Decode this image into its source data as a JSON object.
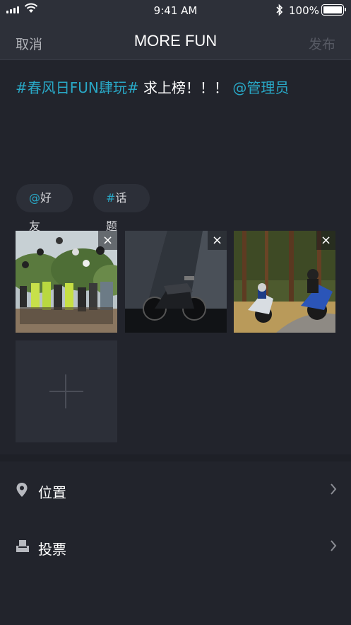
{
  "status_bar": {
    "time": "9:41 AM",
    "battery": "100%",
    "icons": [
      "signal-icon",
      "wifi-icon",
      "bluetooth-icon",
      "battery-icon"
    ]
  },
  "nav": {
    "cancel_label": "取消",
    "title": "MORE FUN",
    "publish_label": "发布"
  },
  "post": {
    "hashtag": "#春风日FUN肆玩#",
    "body": " 求上榜！！！ ",
    "mention": "@管理员"
  },
  "chips": {
    "friend_symbol": "@",
    "friend_label": "好友",
    "topic_symbol": "#",
    "topic_label": "话题"
  },
  "photos": [
    {
      "subject": "group-of-riders-photo"
    },
    {
      "subject": "motorcycle-studio-photo"
    },
    {
      "subject": "riders-in-forest-photo"
    }
  ],
  "options": {
    "location_label": "位置",
    "vote_label": "投票"
  },
  "colors": {
    "accent": "#29a8c6",
    "background": "#22242c",
    "bar": "#2d3039"
  }
}
